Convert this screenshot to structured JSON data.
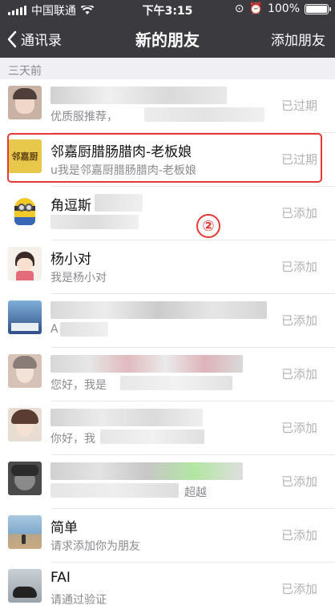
{
  "status_bar": {
    "carrier": "中国联通",
    "time": "下午3:15",
    "battery": "100%"
  },
  "nav": {
    "back_label": "通讯录",
    "title": "新的朋友",
    "action_label": "添加朋友"
  },
  "section": {
    "label": "三天前"
  },
  "items": [
    {
      "name": "",
      "subtitle": "优质服推荐，",
      "state": "已过期",
      "avatar_color": "#c9b1a3"
    },
    {
      "name": "邻嘉厨腊肠腊肉-老板娘",
      "subtitle": "u我是邻嘉厨腊肠腊肉-老板娘",
      "state": "已过期",
      "avatar_text": "邻嘉厨",
      "avatar_color": "#e7c84b"
    },
    {
      "name": "角逗斯",
      "subtitle": "",
      "state": "已添加",
      "avatar_color": "#f2c928"
    },
    {
      "name": "杨小对",
      "subtitle": "我是杨小对",
      "state": "已添加",
      "avatar_color": "#f5f0ea"
    },
    {
      "name": "",
      "subtitle": "A",
      "state": "已添加",
      "avatar_color": "#75a4c9"
    },
    {
      "name": "",
      "subtitle": "您好，我是",
      "state": "已添加",
      "avatar_color": "#d7c2b7"
    },
    {
      "name": "",
      "subtitle": "你好，我",
      "state": "已添加",
      "avatar_color": "#e7ddd3"
    },
    {
      "name": "",
      "subtitle": "超越",
      "state": "已添加",
      "avatar_color": "#4a4a4a"
    },
    {
      "name": "简单",
      "subtitle": "请求添加你为朋友",
      "state": "已添加",
      "avatar_color": "#7fa9cb"
    },
    {
      "name": "FAI",
      "subtitle": "请通过验证",
      "state": "已添加",
      "avatar_color": "#9aa3aa"
    }
  ],
  "annotation": {
    "marker": "②"
  }
}
